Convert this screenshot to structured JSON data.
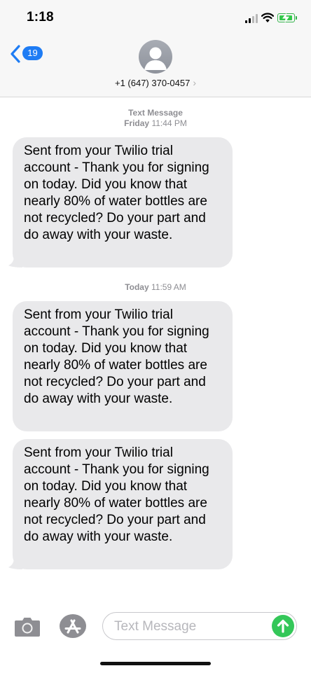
{
  "status_bar": {
    "time": "1:18"
  },
  "header": {
    "back_count": "19",
    "contact": "+1 (647) 370-0457",
    "contact_chevron": "›",
    "avatar_icon": "person-silhouette-icon"
  },
  "messages": {
    "groups": [
      {
        "label": "Text Message",
        "day": "Friday",
        "time": "11:44 PM"
      },
      {
        "day": "Today",
        "time": "11:59 AM"
      }
    ],
    "bubbles": [
      {
        "text": "Sent from your Twilio trial account - Thank you for signing on today. Did you know that nearly 80% of water bottles are not recycled? Do your part and do away with your waste."
      },
      {
        "text": "Sent from your Twilio trial account - Thank you for signing on today. Did you know that nearly 80% of water bottles are not recycled? Do your part and do away with your waste."
      },
      {
        "text": "Sent from your Twilio trial account - Thank you for signing on today. Did you know that nearly 80% of water bottles are not recycled? Do your part and do away with your waste."
      }
    ]
  },
  "input_bar": {
    "placeholder": "Text Message",
    "camera_icon": "camera-icon",
    "apps_icon": "app-store-icon",
    "send_icon": "arrow-up-icon"
  },
  "colors": {
    "accent": "#1e7cf4",
    "bubble_received": "#e9e9eb",
    "send": "#34c759",
    "battery": "#33c74a"
  }
}
